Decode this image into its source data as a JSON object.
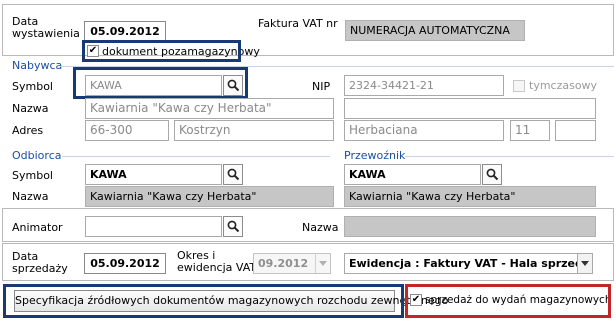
{
  "header": {
    "date_label": "Data\nwystawienia",
    "date_value": "05.09.2012",
    "invoice_label": "Faktura VAT nr",
    "invoice_value": "NUMERACJA AUTOMATYCZNA",
    "non_warehouse_checkbox": {
      "label": "dokument pozamagazynowy",
      "checked": true
    }
  },
  "buyer": {
    "section_title": "Nabywca",
    "symbol_label": "Symbol",
    "symbol_value": "KAWA",
    "nip_label": "NIP",
    "nip_value": "2324-34421-21",
    "temporary_checkbox": {
      "label": "tymczasowy",
      "checked": false
    },
    "name_label": "Nazwa",
    "name_value": "Kawiarnia \"Kawa czy Herbata\"",
    "address_label": "Adres",
    "postal_code": "66-300",
    "city": "Kostrzyn",
    "street": "Herbaciana",
    "house_number": "11",
    "flat_number": ""
  },
  "recipient": {
    "section_title": "Odbiorca",
    "symbol_label": "Symbol",
    "symbol_value": "KAWA",
    "name_label": "Nazwa",
    "name_value": "Kawiarnia \"Kawa czy Herbata\""
  },
  "carrier": {
    "section_title": "Przewoźnik",
    "symbol_value": "KAWA",
    "name_value": "Kawiarnia \"Kawa czy Herbata\""
  },
  "animator": {
    "label": "Animator",
    "value": "",
    "name_label": "Nazwa",
    "name_value": ""
  },
  "sale": {
    "date_label": "Data\nsprzedaży",
    "date_value": "05.09.2012",
    "period_label": "Okres i\newidencja VAT",
    "period_value": "09.2012",
    "register_value": "Ewidencja : Faktury VAT - Hala sprzeda"
  },
  "footer": {
    "spec_button_label": "Specyfikacja źródłowych dokumentów magazynowych rozchodu zewnętrznego",
    "sale_to_warehouse_checkbox": {
      "label": "sprzedaż do wydań magazynowych",
      "checked": true
    }
  },
  "colors": {
    "highlight_blue": "#163a73",
    "highlight_red": "#c22727",
    "section_title": "#1a4fa3",
    "readonly_field": "#c6c6c6"
  },
  "icons": [
    "magnifier-icon",
    "checkmark-icon",
    "dropdown-arrow-icon"
  ]
}
